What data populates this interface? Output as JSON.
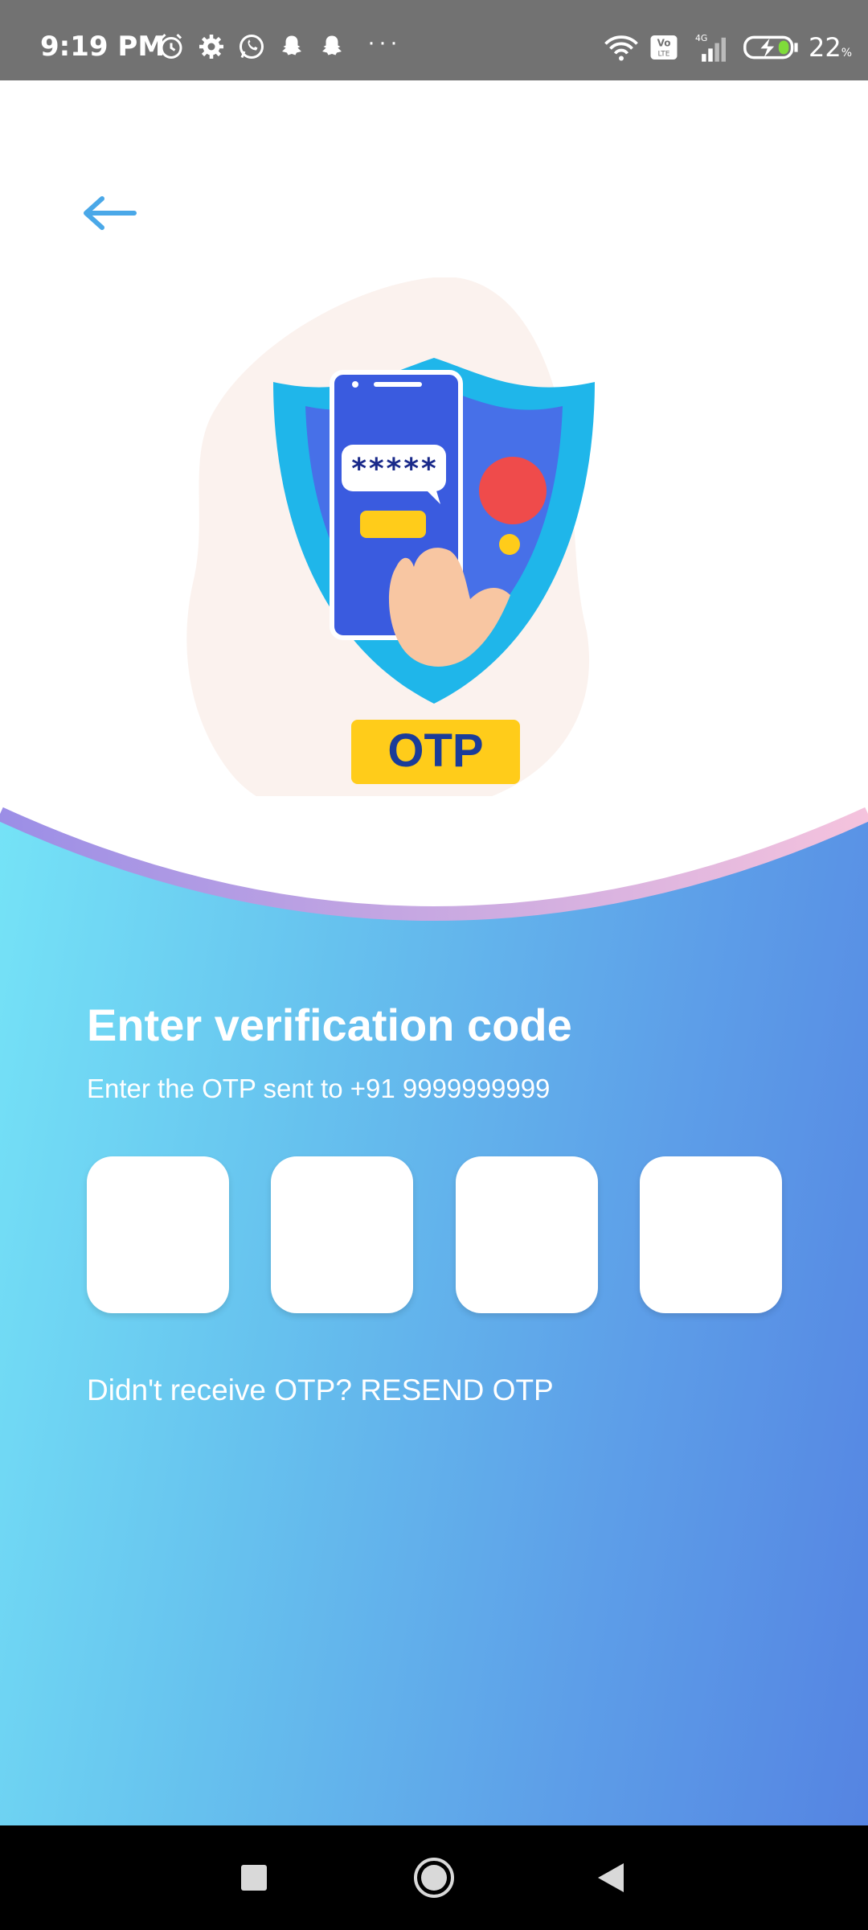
{
  "status_bar": {
    "time": "9:19 PM",
    "more": "···",
    "battery_percent": "22",
    "battery_unit": "%",
    "network_label": "4G",
    "volte_label": "Vo LTE",
    "icons": [
      "alarm-icon",
      "settings-icon",
      "whatsapp-icon",
      "snapchat-icon",
      "snapchat-icon",
      "wifi-icon",
      "volte-icon",
      "signal-icon",
      "battery-charging-icon"
    ]
  },
  "header": {
    "back_icon": "arrow-left-icon"
  },
  "illustration": {
    "otp_badge": "OTP",
    "message_stars": "*****"
  },
  "main": {
    "title": "Enter verification code",
    "subtitle": "Enter the OTP sent to +91 9999999999",
    "otp_fields": [
      {
        "value": "",
        "placeholder": ""
      },
      {
        "value": "",
        "placeholder": ""
      },
      {
        "value": "",
        "placeholder": ""
      },
      {
        "value": "",
        "placeholder": ""
      }
    ],
    "resend_prompt": "Didn't receive OTP? ",
    "resend_link": "RESEND OTP"
  },
  "nav_bar": {
    "buttons": [
      "recent-apps-icon",
      "home-icon",
      "back-icon"
    ]
  },
  "colors": {
    "status_bar": "#727272",
    "gradient_start": "#75e3f7",
    "gradient_end": "#5584e2",
    "back_arrow": "#4aa8e8",
    "otp_badge_bg": "#ffcc1a",
    "otp_badge_text": "#1a3c99"
  }
}
